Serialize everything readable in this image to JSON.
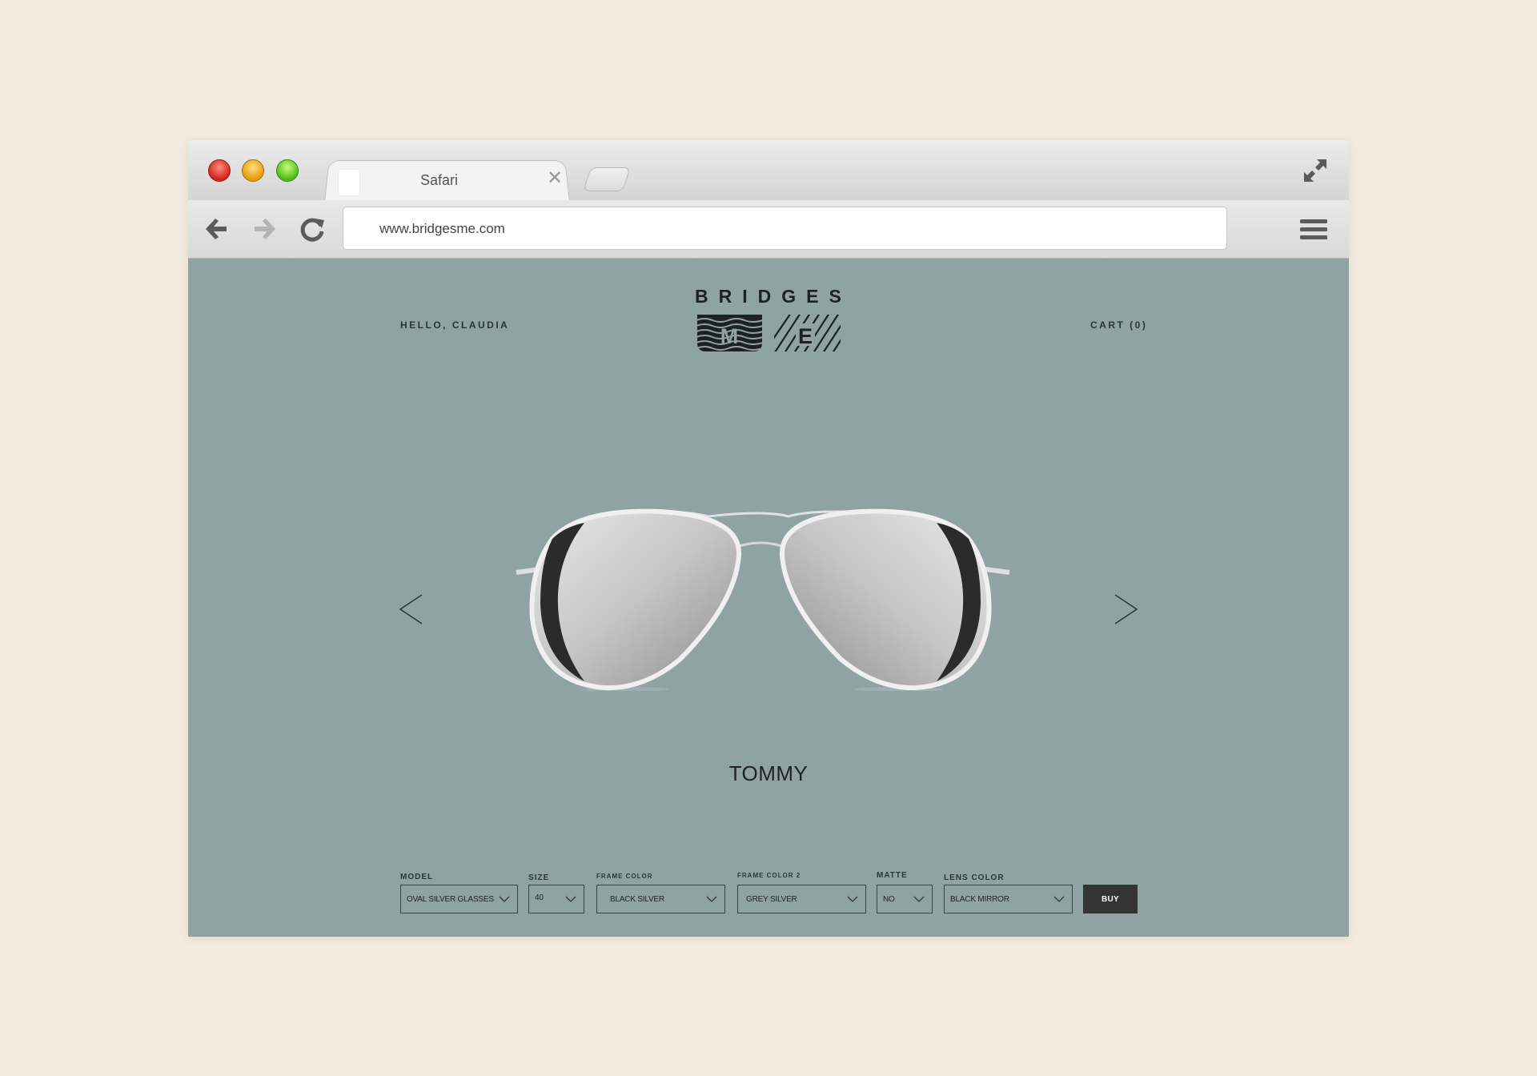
{
  "browser": {
    "tab_title": "Safari",
    "tab_close": "✕",
    "url": "www.bridgesme.com"
  },
  "header": {
    "greeting": "HELLO, CLAUDIA",
    "cart": "CART (0)",
    "logo_top": "BRIDGES",
    "logo_left_letter": "M",
    "logo_right_letter": "E"
  },
  "product": {
    "name": "TOMMY"
  },
  "options": {
    "model": {
      "label": "MODEL",
      "value": "OVAL SILVER GLASSES"
    },
    "size": {
      "label": "SIZE",
      "value": "40"
    },
    "frame_color": {
      "label": "FRAME COLOR",
      "value": "BLACK SILVER"
    },
    "frame_color_2": {
      "label": "FRAME COLOR 2",
      "value": "GREY SILVER"
    },
    "matte": {
      "label": "MATTE",
      "value": "NO"
    },
    "lens_color": {
      "label": "LENS COLOR",
      "value": "BLACK MIRROR"
    },
    "buy_label": "BUY"
  },
  "colors": {
    "page_bg": "#f2eadd",
    "site_bg": "#8fa3a3",
    "buy_bg": "#333333"
  }
}
